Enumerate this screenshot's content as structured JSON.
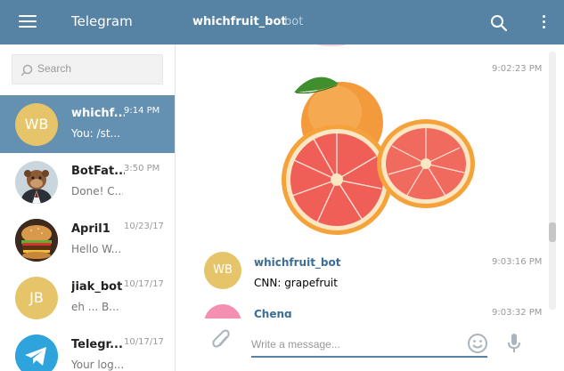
{
  "header": {
    "app_title": "Telegram",
    "chat_title": "whichfruit_bot",
    "chat_subtitle": "bot"
  },
  "search": {
    "placeholder": "Search"
  },
  "dialogs": [
    {
      "name": "whichf...",
      "time": "9:14 PM",
      "preview": "You: /st...",
      "avatar_initials": "WB",
      "avatar_color": "#e6c46a",
      "active": true
    },
    {
      "name": "BotFat...",
      "time": "3:50 PM",
      "preview": "Done! C...",
      "avatar_icon": "botfather-avatar"
    },
    {
      "name": "April1",
      "time": "10/23/17",
      "preview": "Hello W...",
      "avatar_icon": "burger-avatar"
    },
    {
      "name": "jiak_bot",
      "time": "10/17/17",
      "preview": "eh ... B...",
      "avatar_initials": "JB",
      "avatar_color": "#e6c46a"
    },
    {
      "name": "Telegr...",
      "time": "10/17/17",
      "preview": "Your log...",
      "avatar_icon": "telegram-avatar"
    }
  ],
  "chat": {
    "messages": [
      {
        "type": "photo",
        "time": "9:02:23 PM",
        "photo": "grapefruit-image"
      },
      {
        "type": "text",
        "author": "whichfruit_bot",
        "avatar_initials": "WB",
        "avatar_color": "#e6c46a",
        "text": "CNN: grapefruit",
        "time": "9:03:16 PM"
      },
      {
        "type": "text",
        "author": "Cheng",
        "avatar_color": "#f48fb1",
        "text": "",
        "time": "9:03:32 PM"
      }
    ],
    "composer_placeholder": "Write a message..."
  },
  "colors": {
    "header": "#5682a3",
    "active_dialog": "#6490b1",
    "author_link": "#3a6d99"
  }
}
